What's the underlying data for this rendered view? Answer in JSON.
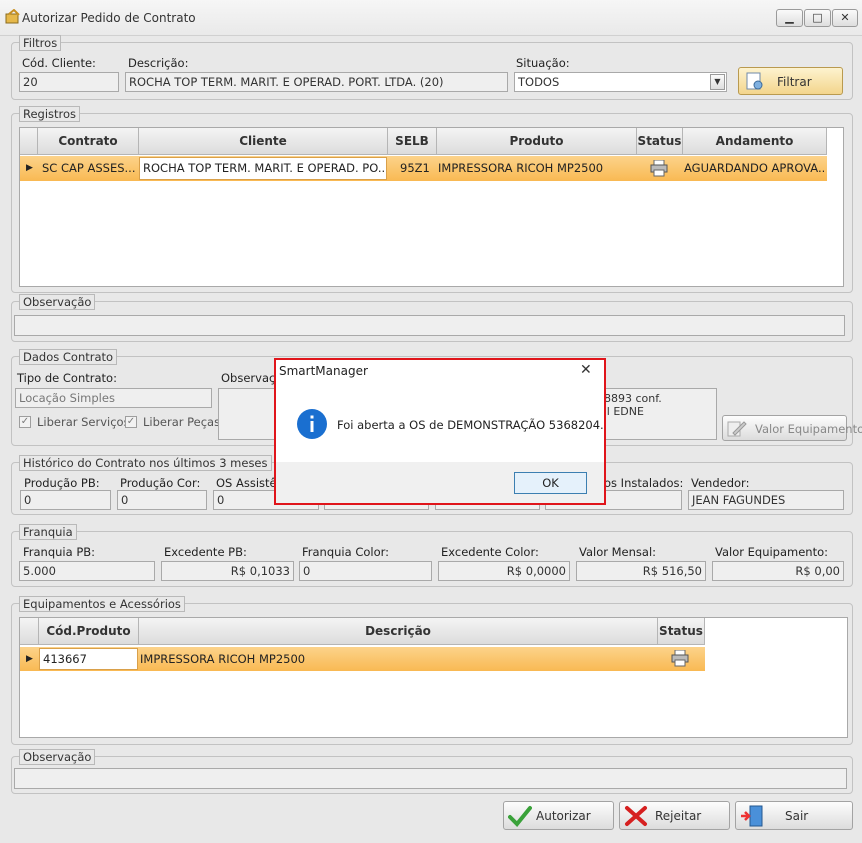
{
  "window": {
    "title": "Autorizar Pedido de Contrato",
    "minimize_icon": "minimize-icon",
    "maximize_icon": "maximize-icon",
    "close_icon": "close-icon"
  },
  "filtros": {
    "legend": "Filtros",
    "cod_cliente_label": "Cód. Cliente:",
    "cod_cliente_value": "20",
    "descricao_label": "Descrição:",
    "descricao_value": "ROCHA TOP TERM. MARIT. E OPERAD. PORT. LTDA. (20)",
    "situacao_label": "Situação:",
    "situacao_value": "TODOS",
    "filtrar_label": "Filtrar"
  },
  "registros": {
    "legend": "Registros",
    "columns": [
      "Contrato",
      "Cliente",
      "SELB",
      "Produto",
      "Status",
      "Andamento"
    ],
    "rows": [
      {
        "contrato": "SC CAP ASSES...",
        "cliente": "ROCHA TOP TERM. MARIT. E OPERAD. PO...",
        "selb": "95Z1",
        "produto": "IMPRESSORA RICOH MP2500",
        "status_icon": "printer-icon",
        "andamento": "AGUARDANDO APROVA..."
      }
    ]
  },
  "observacao1": {
    "legend": "Observação",
    "value": ""
  },
  "dados_contrato": {
    "legend": "Dados Contrato",
    "tipo_label": "Tipo de Contrato:",
    "tipo_value": "Locação Simples",
    "liberar_servicos": "Liberar Serviços",
    "liberar_pecas": "Liberar Peças",
    "observacao_label": "Observaçã",
    "obs_line1": "28893 conf.",
    "obs_line2": "ail EDNE",
    "valor_equipamento_button": "Valor Equipamento"
  },
  "historico": {
    "legend": "Histórico do Contrato nos últimos 3 meses",
    "producao_pb_label": "Produção PB:",
    "producao_pb_value": "0",
    "producao_cor_label": "Produção Cor:",
    "producao_cor_value": "0",
    "os_assist_label": "OS Assistê",
    "os_assist_value": "0",
    "instalados_label": "os Instalados:",
    "vendedor_label": "Vendedor:",
    "vendedor_value": "JEAN FAGUNDES"
  },
  "franquia": {
    "legend": "Franquia",
    "franquia_pb_label": "Franquia PB:",
    "franquia_pb_value": "5.000",
    "excedente_pb_label": "Excedente PB:",
    "excedente_pb_value": "R$ 0,1033",
    "franquia_color_label": "Franquia Color:",
    "franquia_color_value": "0",
    "excedente_color_label": "Excedente Color:",
    "excedente_color_value": "R$ 0,0000",
    "valor_mensal_label": "Valor Mensal:",
    "valor_mensal_value": "R$ 516,50",
    "valor_equip_label": "Valor Equipamento:",
    "valor_equip_value": "R$ 0,00"
  },
  "equipamentos": {
    "legend": "Equipamentos e Acessórios",
    "columns": [
      "Cód.Produto",
      "Descrição",
      "Status"
    ],
    "rows": [
      {
        "cod": "413667",
        "descricao": "IMPRESSORA RICOH MP2500",
        "status_icon": "printer-icon"
      }
    ]
  },
  "observacao2": {
    "legend": "Observação",
    "value": ""
  },
  "actions": {
    "autorizar": "Autorizar",
    "rejeitar": "Rejeitar",
    "sair": "Sair"
  },
  "dialog": {
    "title": "SmartManager",
    "message": "Foi aberta a OS de DEMONSTRAÇÃO 5368204.",
    "ok": "OK",
    "close_glyph": "✕"
  },
  "colors": {
    "accent_row": "#f9b953",
    "dialog_border": "#e0151b",
    "info_blue": "#1a6fd0"
  }
}
